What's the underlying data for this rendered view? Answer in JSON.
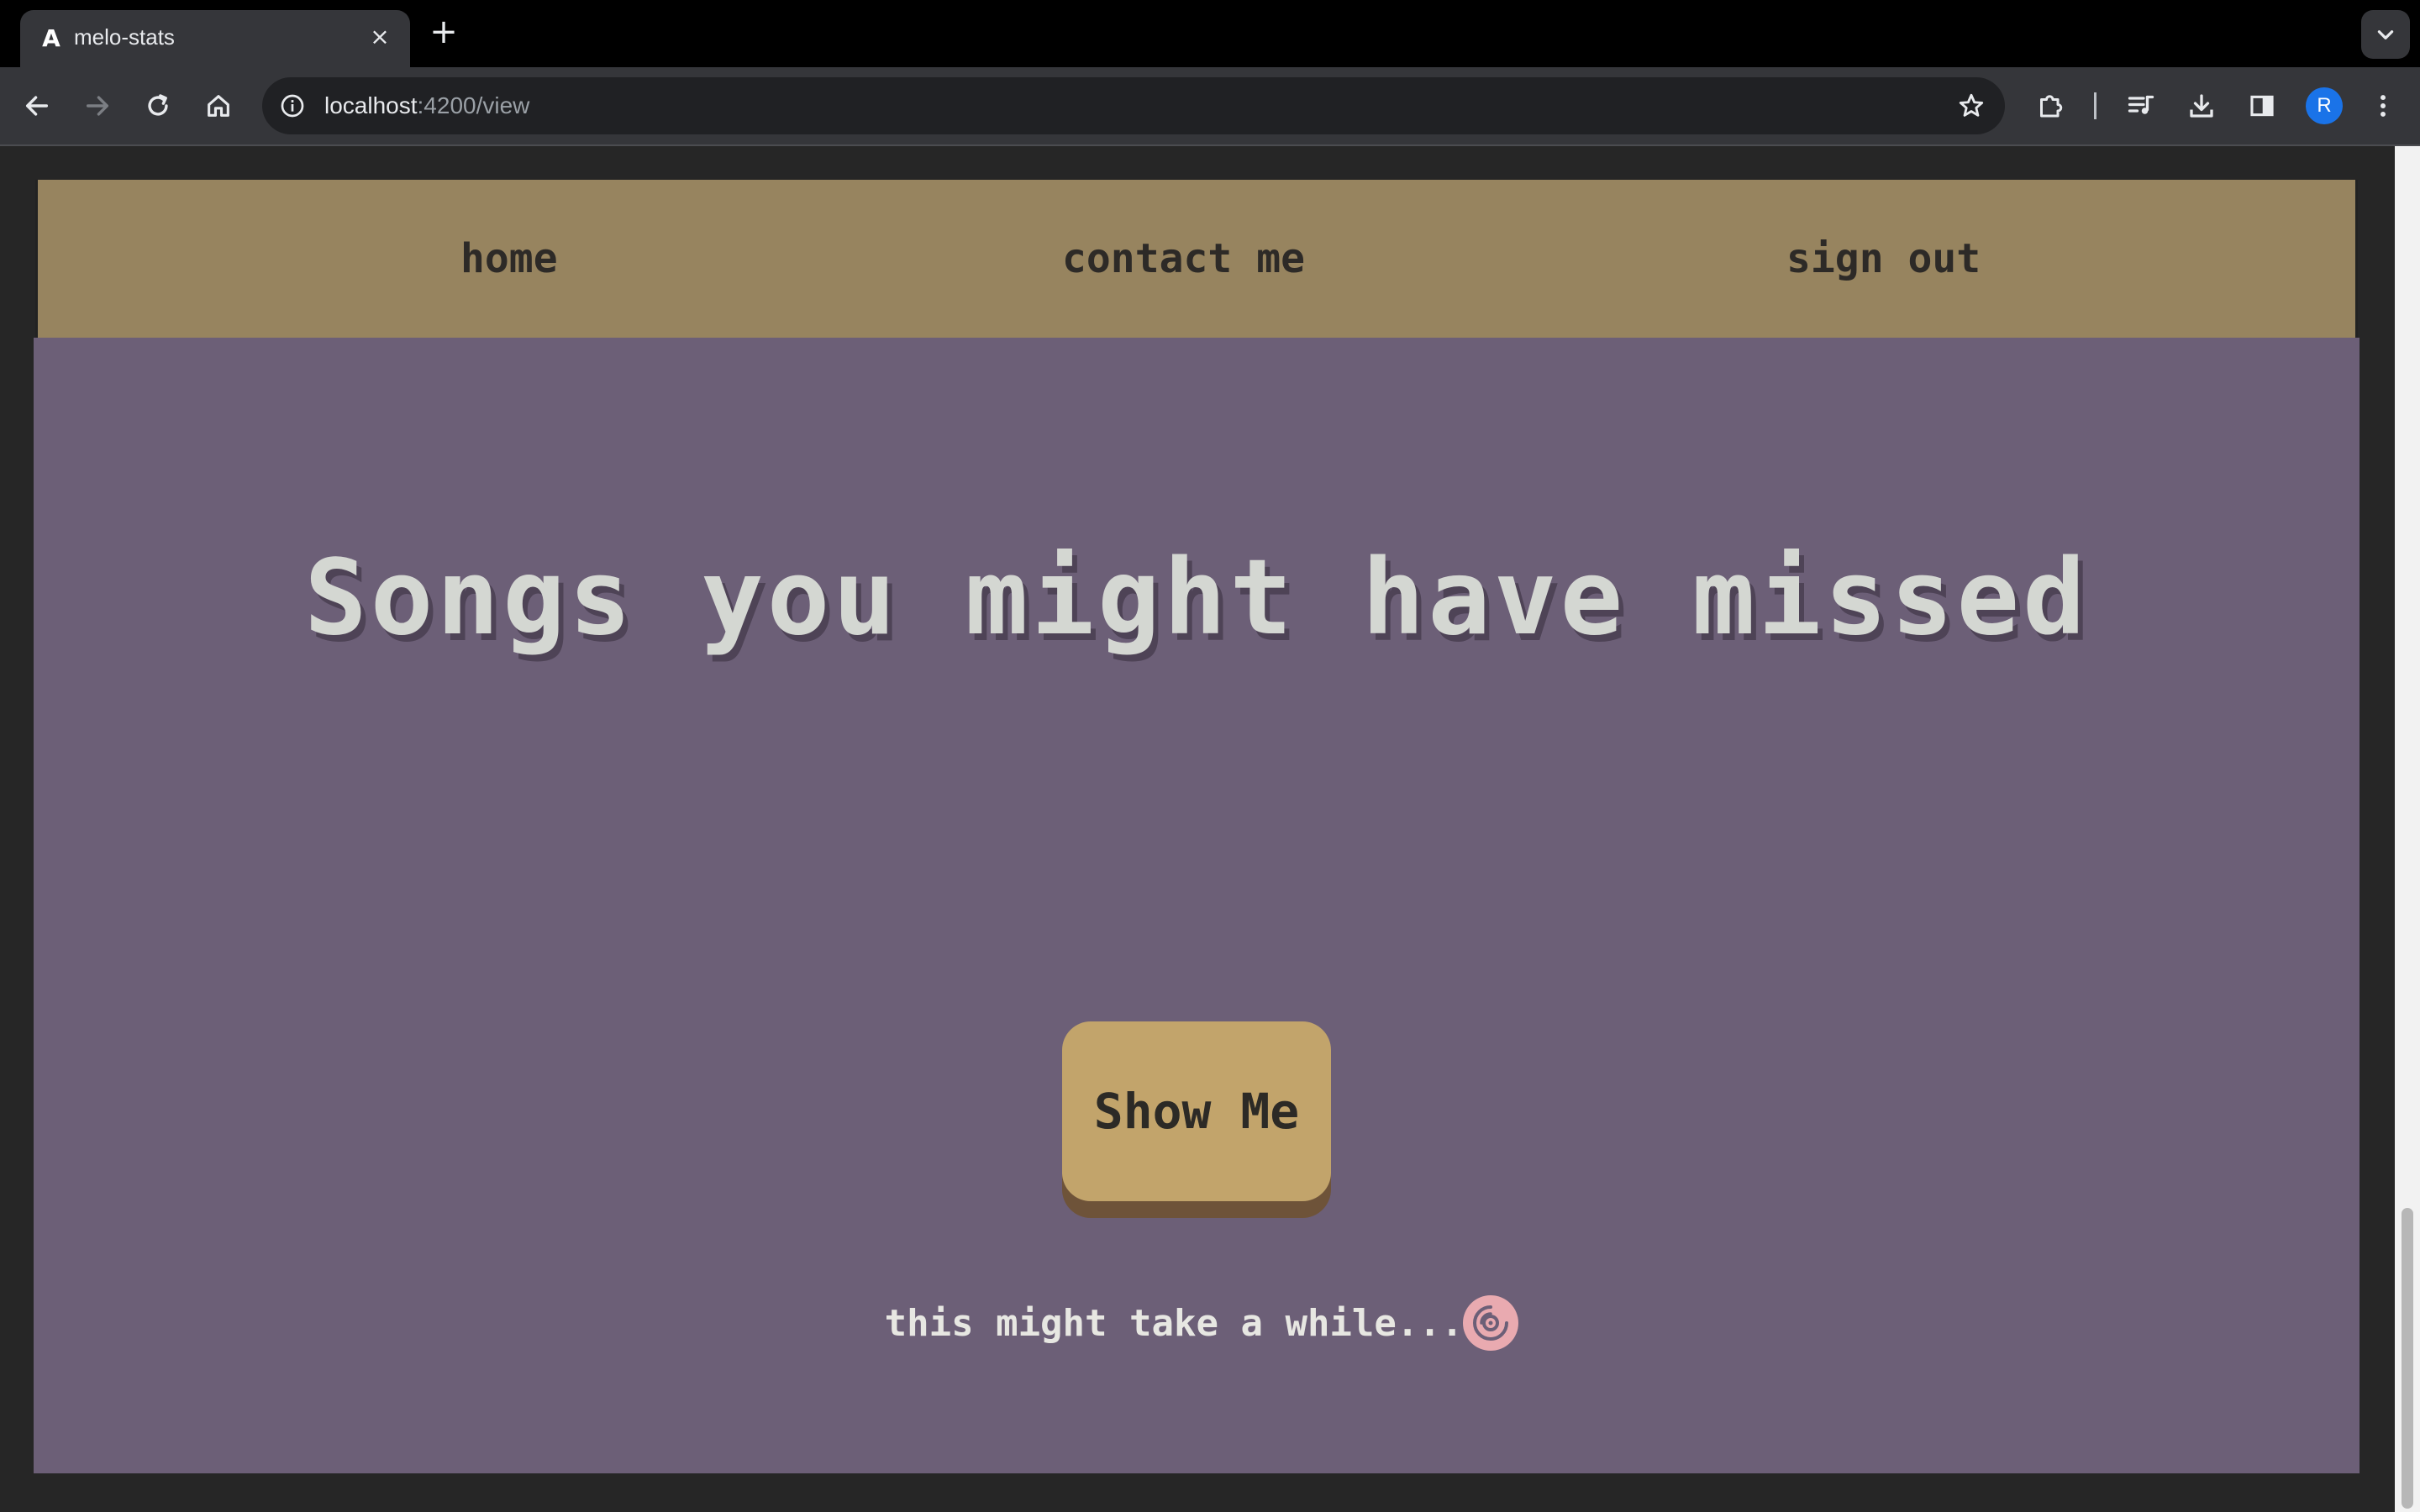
{
  "browser": {
    "tab": {
      "title": "melo-stats",
      "favicon": "angular-icon",
      "favicon_glyph": "A"
    },
    "new_tab_glyph": "+",
    "close_glyph": "×",
    "url": {
      "host": "localhost",
      "path": ":4200/view"
    },
    "profile_initial": "R"
  },
  "nav": {
    "home": "home",
    "contact": "contact me",
    "sign_out": "sign out"
  },
  "main": {
    "headline": "Songs you might have missed",
    "button_label": "Show Me",
    "loading_text": "this might take a while..."
  },
  "colors": {
    "navbar_bg": "#97845f",
    "content_bg": "#6c5f77",
    "button_bg": "#c2a46b",
    "button_shadow": "#6e5339",
    "headline": "#d4d7d2",
    "disc_icon": "#e9aab0"
  }
}
